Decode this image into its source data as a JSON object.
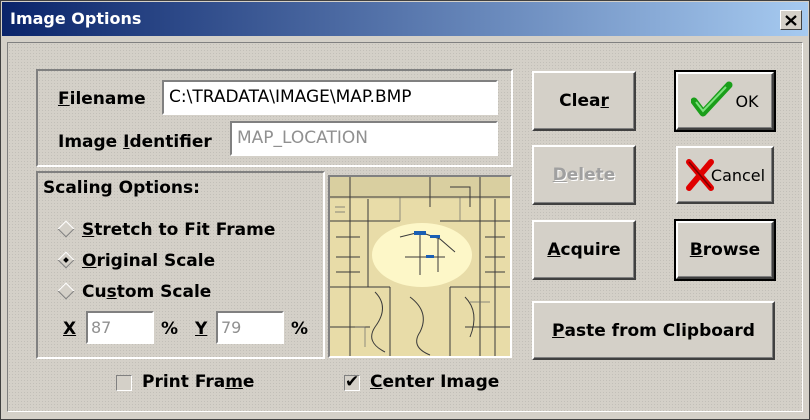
{
  "window": {
    "title": "Image Options",
    "close_glyph": "×"
  },
  "file": {
    "filename_label_u": "F",
    "filename_label_rest": "ilename",
    "filename_value": "C:\\TRADATA\\IMAGE\\MAP.BMP",
    "identifier_label_pre": "Image ",
    "identifier_label_u": "I",
    "identifier_label_rest": "dentifier",
    "identifier_value": "MAP_LOCATION"
  },
  "scaling": {
    "title": "Scaling Options:",
    "options": [
      {
        "u": "S",
        "rest": "tretch to Fit Frame",
        "selected": false
      },
      {
        "u": "O",
        "rest": "riginal Scale",
        "selected": true
      },
      {
        "pre": "Cu",
        "u": "s",
        "rest": "tom Scale",
        "selected": false
      }
    ],
    "x_label": "X",
    "x_value": "87",
    "x_unit": "%",
    "y_label": "Y",
    "y_value": "79",
    "y_unit": "%"
  },
  "buttons": {
    "clear_pre": "Clea",
    "clear_u": "r",
    "delete_u": "D",
    "delete_rest": "elete",
    "acquire_u": "A",
    "acquire_rest": "cquire",
    "paste_u": "P",
    "paste_rest": "aste from Clipboard",
    "ok_label": "OK",
    "cancel_label": "Cancel",
    "browse_u": "B",
    "browse_rest": "rowse"
  },
  "options": {
    "print_frame_pre": "Print Fra",
    "print_frame_u": "m",
    "print_frame_rest": "e",
    "print_frame_checked": false,
    "center_u": "C",
    "center_rest": "enter Image",
    "center_checked": true
  },
  "preview": {
    "description_icon": "map-preview"
  },
  "colors": {
    "title_start": "#0a246a",
    "title_end": "#a6caf0",
    "face": "#d4d0c8",
    "ok_check": "#1a9e1a",
    "cancel_x": "#e00000"
  }
}
